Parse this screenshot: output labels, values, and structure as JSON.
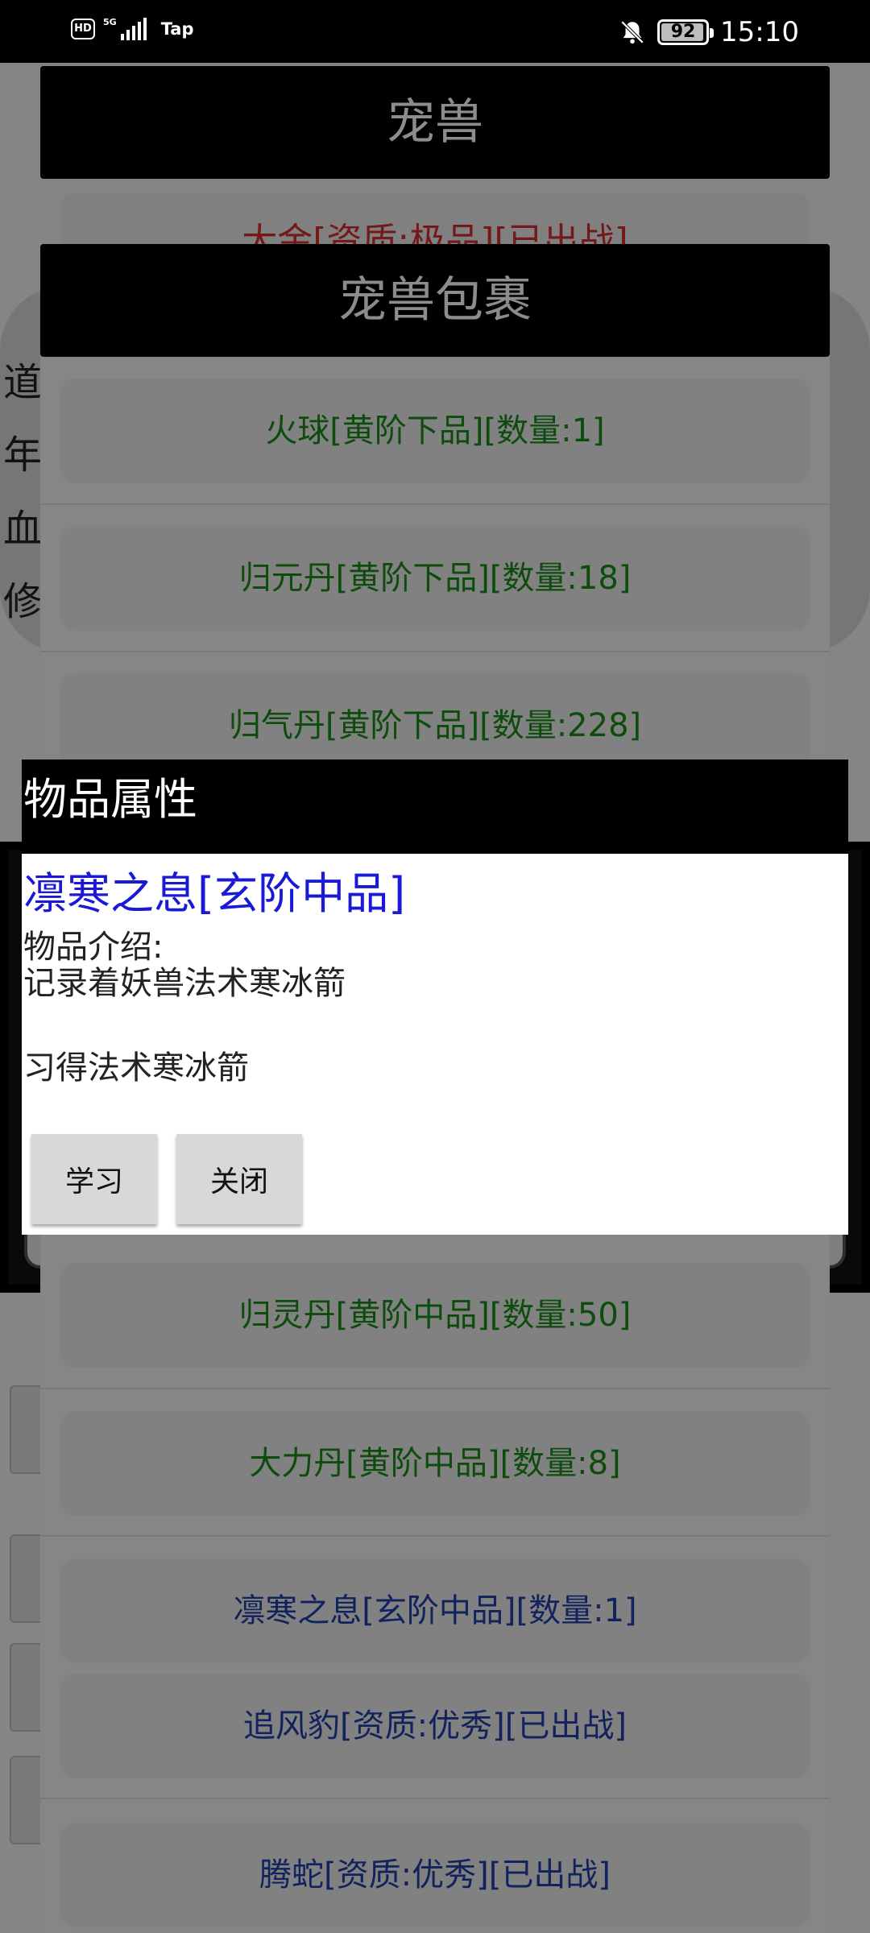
{
  "status_bar": {
    "hd_label": "HD",
    "network_label": "5G",
    "carrier": "Tap",
    "battery_level": "92",
    "time": "15:10"
  },
  "background": {
    "stat_labels": [
      "道",
      "年",
      "血",
      "修"
    ],
    "side_buttons": [
      "",
      "",
      "",
      ""
    ]
  },
  "pet_window": {
    "title": "宠兽",
    "first_row": "大金[资质:极品][已出战]"
  },
  "bag_window": {
    "title": "宠兽包裹",
    "items": [
      {
        "label": "火球[黄阶下品][数量:1]",
        "color": "green"
      },
      {
        "label": "归元丹[黄阶下品][数量:18]",
        "color": "green"
      },
      {
        "label": "归气丹[黄阶下品][数量:228]",
        "color": "green"
      },
      {
        "label": "归灵丹[黄阶中品][数量:50]",
        "color": "green"
      },
      {
        "label": "大力丹[黄阶中品][数量:8]",
        "color": "green"
      },
      {
        "label": "凛寒之息[玄阶中品][数量:1]",
        "color": "blue"
      },
      {
        "label": "追风豹[资质:优秀][已出战]",
        "color": "blue"
      },
      {
        "label": "腾蛇[资质:优秀][已出战]",
        "color": "blue"
      }
    ]
  },
  "item_dialog": {
    "title": "物品属性",
    "item_name": "凛寒之息[玄阶中品]",
    "description_label": "物品介绍:",
    "description": "记录着妖兽法术寒冰箭",
    "effect": "习得法术寒冰箭",
    "learn_button": "学习",
    "close_button": "关闭"
  }
}
